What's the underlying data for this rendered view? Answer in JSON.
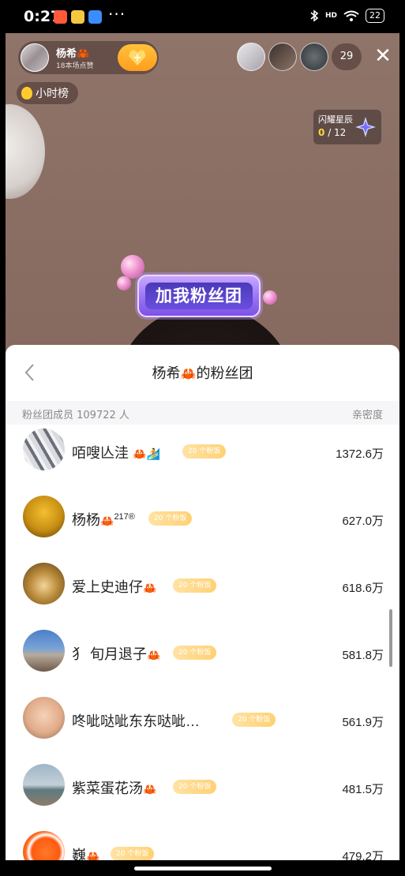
{
  "status_bar": {
    "time": "22:27",
    "time_display": "0:27",
    "dots": "···",
    "battery": "22",
    "network": "HD"
  },
  "host": {
    "name": "杨希🦀",
    "sub": "18本场点赞"
  },
  "viewers": {
    "count": "29"
  },
  "rank": {
    "label": "小时榜"
  },
  "star": {
    "title": "闪耀星辰",
    "current": "0",
    "total": "/ 12"
  },
  "fan_badge": {
    "text": "加我粉丝团"
  },
  "sheet": {
    "title_prefix": "杨希",
    "title_suffix": "的粉丝团",
    "member_label": "粉丝团成员 109722 人",
    "intimacy_label": "亲密度"
  },
  "fans": [
    {
      "name": "咟嗖亾洼",
      "level": "20 个粉饭",
      "score": "1372.6万"
    },
    {
      "name": "杨杨",
      "sup": "217®",
      "level": "20 个粉饭",
      "score": "627.0万"
    },
    {
      "name": "爱上史迪仔",
      "level": "20 个粉饭",
      "score": "618.6万"
    },
    {
      "name": "犭 旬月退子",
      "level": "20 个粉饭",
      "score": "581.8万"
    },
    {
      "name": "咚呲哒呲东东哒呲…",
      "level": "20 个粉饭",
      "score": "561.9万"
    },
    {
      "name": "紫菜蛋花汤",
      "level": "20 个粉饭",
      "score": "481.5万"
    },
    {
      "name": "巍",
      "level": "20 个粉饭",
      "score": "479.2万"
    }
  ],
  "colors": {
    "accent": "#ffb22a",
    "level_badge": "#ffd174",
    "fan_badge": "#7c52e6"
  }
}
